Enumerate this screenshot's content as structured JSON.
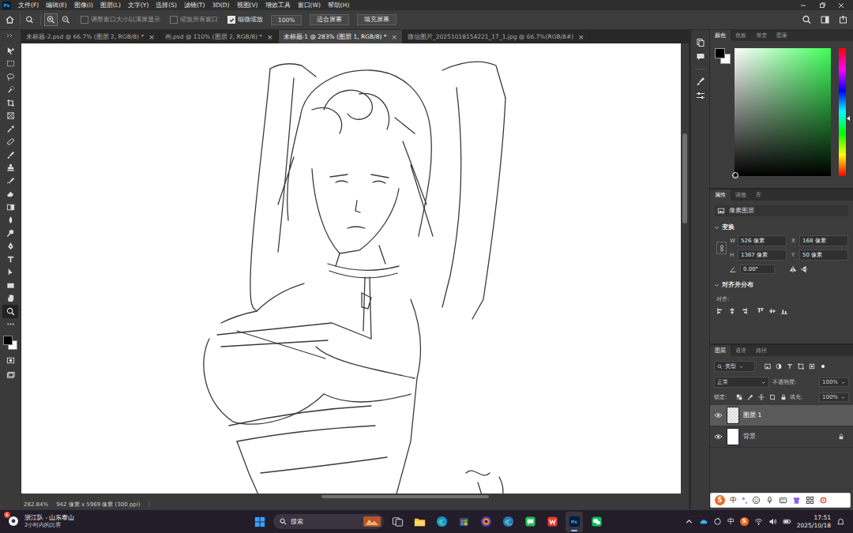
{
  "menubar": {
    "logo": "Ps",
    "items": [
      "文件(F)",
      "编辑(E)",
      "图像(I)",
      "图层(L)",
      "文字(Y)",
      "选择(S)",
      "滤镜(T)",
      "3D(D)",
      "视图(V)",
      "增效工具",
      "窗口(W)",
      "帮助(H)"
    ]
  },
  "options_bar": {
    "checkboxes": [
      {
        "label": "调整窗口大小以满屏显示",
        "checked": false
      },
      {
        "label": "缩放所有窗口",
        "checked": false
      },
      {
        "label": "细微缩放",
        "checked": true
      }
    ],
    "buttons": [
      "100%",
      "适合屏幕",
      "填充屏幕"
    ]
  },
  "tabs": [
    {
      "label": "未标题-2.psd @ 66.7% (图层 2, RGB/8) *",
      "close": "×",
      "selected": false
    },
    {
      "label": "画.psd @ 110% (图层 2, RGB/8) *",
      "close": "×",
      "selected": false
    },
    {
      "label": "未标题-1 @ 283% (图层 1, RGB/8) *",
      "close": "×",
      "selected": true
    },
    {
      "label": "微信图片_20251018154221_17_1.jpg @ 66.7%(RGB/8#)",
      "close": "×",
      "selected": false
    }
  ],
  "tools": [
    {
      "kind": "move",
      "selected": false
    },
    {
      "kind": "marquee",
      "selected": false
    },
    {
      "kind": "lasso",
      "selected": false
    },
    {
      "kind": "quickselect",
      "selected": false
    },
    {
      "kind": "crop",
      "selected": false
    },
    {
      "kind": "frame",
      "selected": false
    },
    {
      "kind": "eyedropper",
      "selected": false
    },
    {
      "kind": "healing",
      "selected": false
    },
    {
      "kind": "brush",
      "selected": false
    },
    {
      "kind": "stamp",
      "selected": false
    },
    {
      "kind": "history",
      "selected": false
    },
    {
      "kind": "eraser",
      "selected": false
    },
    {
      "kind": "gradient",
      "selected": false
    },
    {
      "kind": "blur",
      "selected": false
    },
    {
      "kind": "dodge",
      "selected": false
    },
    {
      "kind": "pen",
      "selected": false
    },
    {
      "kind": "type",
      "selected": false
    },
    {
      "kind": "pathselect",
      "selected": false
    },
    {
      "kind": "rect",
      "selected": false
    },
    {
      "kind": "hand",
      "selected": false
    },
    {
      "kind": "zoom",
      "selected": true
    },
    {
      "kind": "more",
      "selected": false
    }
  ],
  "canvas": {
    "scroll_v": {
      "start": 0.2,
      "size": 0.2
    },
    "scroll_h": {
      "start": 0.45,
      "size": 0.25
    }
  },
  "status_bar": {
    "zoom": "282.84%",
    "info": "942 像素 x 5969 像素 (300 ppi)",
    "arrow": "〉"
  },
  "color_panel": {
    "tabs": [
      {
        "label": "颜色",
        "selected": true
      },
      {
        "label": "色板",
        "selected": false
      },
      {
        "label": "渐变",
        "selected": false
      },
      {
        "label": "图案",
        "selected": false
      }
    ],
    "foreground": "#000000",
    "background": "#ffffff",
    "hue": "#3dff5a",
    "hue_level": 0.55
  },
  "properties_panel": {
    "tabs": [
      {
        "label": "属性",
        "selected": true
      },
      {
        "label": "调整",
        "selected": false
      },
      {
        "label": "库",
        "selected": false
      }
    ],
    "layer_kind": "像素图层",
    "transform": {
      "title": "变换",
      "fields": [
        {
          "label": "W",
          "value": "526 像素"
        },
        {
          "label": "X",
          "value": "168 像素"
        },
        {
          "label": "H",
          "value": "1367 像素"
        },
        {
          "label": "Y",
          "value": "50 像素"
        }
      ],
      "angle": "0.00°"
    },
    "align": {
      "title": "对齐并分布",
      "label": "对齐:"
    }
  },
  "layers_panel": {
    "tabs": [
      {
        "label": "图层",
        "selected": true
      },
      {
        "label": "通道",
        "selected": false
      },
      {
        "label": "路径",
        "selected": false
      }
    ],
    "filter": "类型",
    "blend_mode": "正常",
    "opacity_label": "不透明度:",
    "opacity": "100%",
    "lock_label": "锁定:",
    "fill_label": "填充:",
    "fill": "100%",
    "layers": [
      {
        "name": "图层 1",
        "visible": true,
        "selected": true,
        "locked": false,
        "kind": "transparent"
      },
      {
        "name": "背景",
        "visible": true,
        "selected": false,
        "locked": true,
        "kind": "white"
      }
    ]
  },
  "ime_bar": {
    "logo": "S",
    "mode": "中",
    "punct": "°,"
  },
  "taskbar": {
    "news": {
      "badge": "6",
      "title": "浙江队 - 山东泰山",
      "subtitle": "2小时内的比赛"
    },
    "search": "搜索",
    "apps": [
      {
        "kind": "taskview",
        "label": "",
        "active": false
      },
      {
        "kind": "explorer",
        "label": "",
        "active": false
      },
      {
        "kind": "edge",
        "label": "",
        "active": false
      },
      {
        "kind": "store",
        "label": "",
        "active": false
      },
      {
        "kind": "browser",
        "label": "",
        "active": false
      },
      {
        "kind": "edge2",
        "label": "",
        "active": false
      },
      {
        "kind": "chat",
        "label": "",
        "active": false
      },
      {
        "kind": "wps",
        "label": "",
        "active": false
      },
      {
        "kind": "ps",
        "label": "Ps",
        "active": true
      },
      {
        "kind": "wechat",
        "label": "",
        "active": false
      }
    ],
    "tray": {
      "ime_logo": "S",
      "ime": "中",
      "time": "17:51",
      "date": "2025/10/18"
    }
  }
}
